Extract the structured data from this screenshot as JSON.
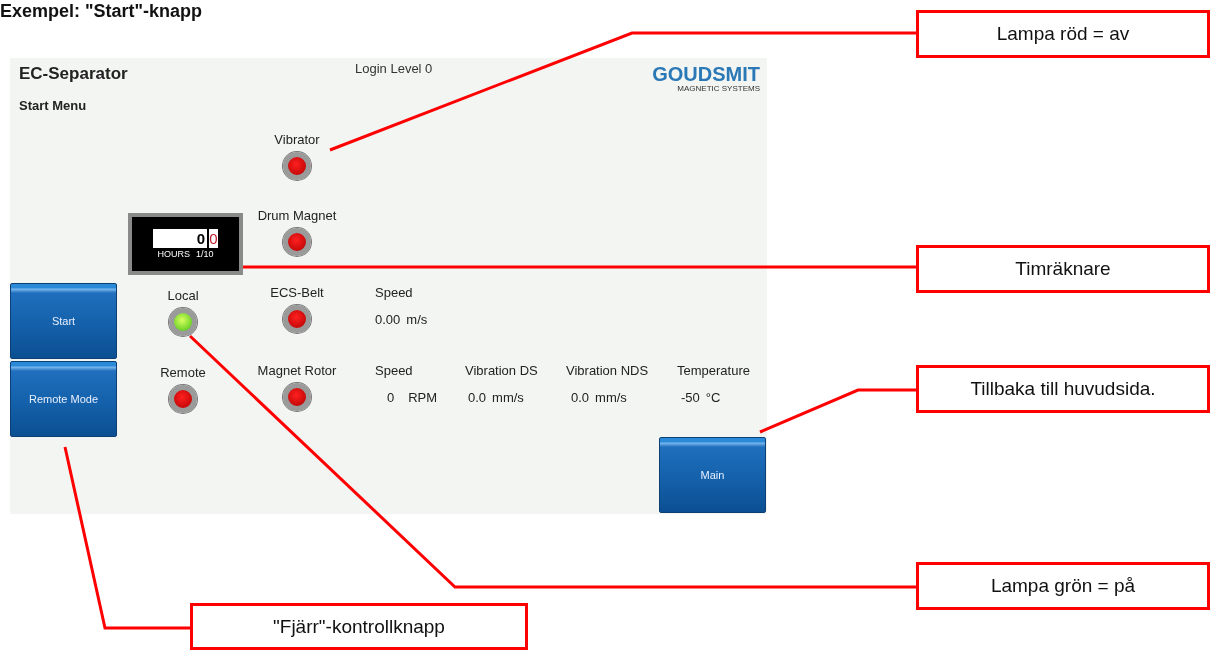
{
  "heading": "Exempel: \"Start\"-knapp",
  "screen": {
    "title": "EC-Separator",
    "subtitle": "Start Menu",
    "login": "Login Level 0",
    "logo": {
      "name": "GOUDSMIT",
      "tagline": "MAGNETIC SYSTEMS"
    },
    "lamps": [
      {
        "label": "Vibrator",
        "on": false
      },
      {
        "label": "Drum Magnet",
        "on": false
      },
      {
        "label": "Local",
        "on": true
      },
      {
        "label": "ECS-Belt",
        "on": false
      },
      {
        "label": "Remote",
        "on": false
      },
      {
        "label": "Magnet Rotor",
        "on": false
      }
    ],
    "hour_counter": {
      "hours": "0",
      "tenths": "0",
      "unit": "HOURS",
      "scale": "1/10"
    },
    "readings": [
      {
        "label": "Speed",
        "value": "0.00",
        "unit": "m/s"
      },
      {
        "label": "Speed",
        "value": "0",
        "unit": "RPM"
      },
      {
        "label": "Vibration DS",
        "value": "0.0",
        "unit": "mm/s"
      },
      {
        "label": "Vibration NDS",
        "value": "0.0",
        "unit": "mm/s"
      },
      {
        "label": "Temperature",
        "value": "-50",
        "unit": "°C"
      }
    ],
    "buttons": [
      {
        "label": "Start"
      },
      {
        "label": "Remote Mode"
      },
      {
        "label": "Main"
      }
    ]
  },
  "callouts": [
    {
      "text": "Lampa röd = av"
    },
    {
      "text": "Timräknare"
    },
    {
      "text": "Tillbaka till huvudsida."
    },
    {
      "text": "Lampa grön = på"
    },
    {
      "text": "\"Fjärr\"-kontrollknapp"
    }
  ]
}
